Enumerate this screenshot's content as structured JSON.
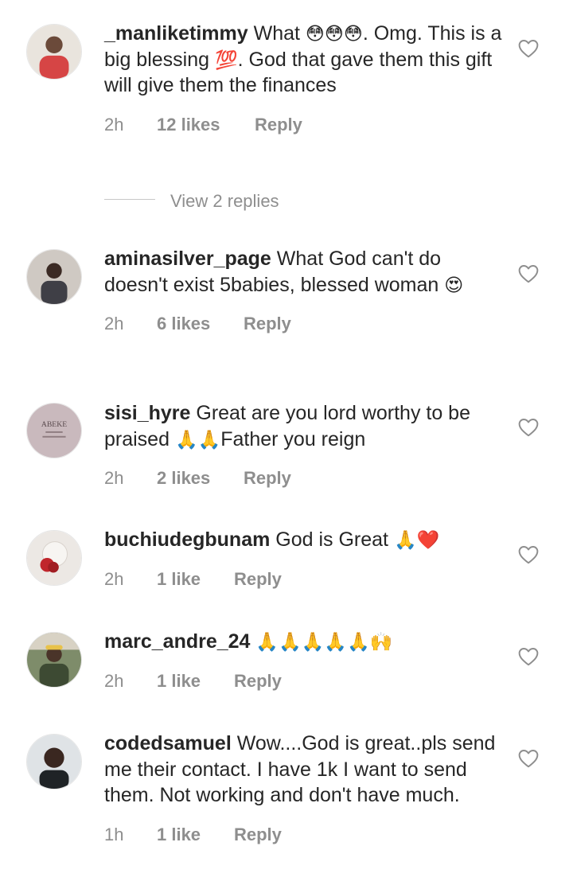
{
  "comments": [
    {
      "username": "_manliketimmy",
      "text_parts": [
        "What ",
        "😳😳😳",
        ". Omg. This is a big blessing ",
        "💯",
        ". God that gave them this gift will give them the finances"
      ],
      "time": "2h",
      "likes": "12 likes",
      "reply": "Reply"
    },
    {
      "username": "aminasilver_page",
      "text_parts": [
        "What God can't do doesn't exist 5babies, blessed woman ",
        "😍"
      ],
      "time": "2h",
      "likes": "6 likes",
      "reply": "Reply"
    },
    {
      "username": "sisi_hyre",
      "text_parts": [
        "Great are you lord worthy to be praised ",
        "🙏🙏",
        "Father you reign"
      ],
      "time": "2h",
      "likes": "2 likes",
      "reply": "Reply"
    },
    {
      "username": "buchiudegbunam",
      "text_parts": [
        "God is Great ",
        "🙏❤️"
      ],
      "time": "2h",
      "likes": "1 like",
      "reply": "Reply"
    },
    {
      "username": "marc_andre_24",
      "text_parts": [
        "",
        "🙏🙏🙏🙏🙏🙌"
      ],
      "time": "2h",
      "likes": "1 like",
      "reply": "Reply"
    },
    {
      "username": "codedsamuel",
      "text_parts": [
        "Wow....God is great..pls send me their contact. I have 1k I want to send them. Not working and don't have much."
      ],
      "time": "1h",
      "likes": "1 like",
      "reply": "Reply"
    }
  ],
  "view_replies": "View 2 replies",
  "icons": {
    "like": "heart-outline-icon"
  },
  "colors": {
    "text": "#262626",
    "meta": "#8e8e8e",
    "line": "#c7c7c7"
  }
}
